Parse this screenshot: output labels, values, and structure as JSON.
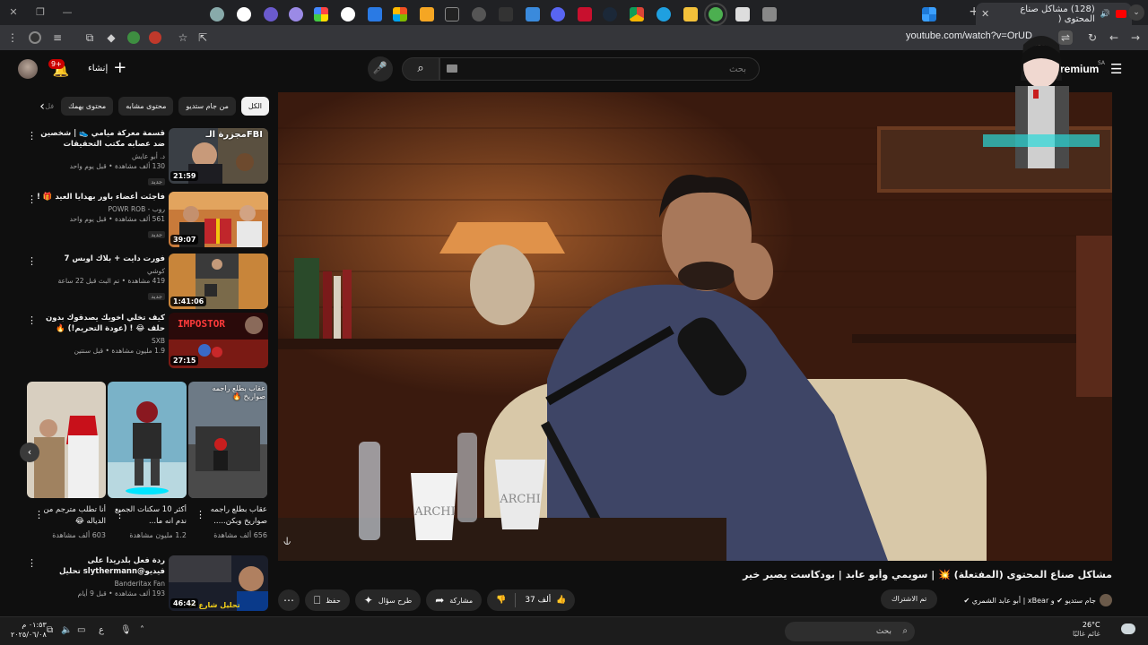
{
  "browser": {
    "tab_title": "(128) مشاكل صناع المحتوى (",
    "url": "youtube.com/watch?v=OrUD"
  },
  "header": {
    "search_placeholder": "بحث",
    "create_label": "إنشاء",
    "notif_badge": "9+",
    "premium_label": "Premium",
    "premium_region": "SA"
  },
  "chips": [
    {
      "label": "الكل",
      "active": true
    },
    {
      "label": "من جام ستديو"
    },
    {
      "label": "محتوى مشابه"
    },
    {
      "label": "محتوى يهمك"
    },
    {
      "label": "فل"
    }
  ],
  "recommendations": [
    {
      "title": "قسمة معركة ميامي 👟 | شخصين ضد عصابه مكتب التحقيقات الفدرالي!",
      "channel": "د. أبو عايش",
      "stats": "130 ألف مشاهدة • قبل يوم واحد",
      "duration": "21:59",
      "badge": "جديد",
      "thumb_text": "مجزرة الـFBI"
    },
    {
      "title": "فاجئت أعضاء باور بهدايا العيد 🎁 !",
      "channel": "روب - POWR ROB",
      "stats": "561 ألف مشاهدة • قبل يوم واحد",
      "duration": "39:07",
      "badge": "جديد",
      "thumb_text": ""
    },
    {
      "title": "فورت دايت + بلاك اوبس 7",
      "channel": "كوشي",
      "stats": "419 مشاهدة • تم البث قبل 22 ساعة",
      "duration": "1:41:06",
      "badge": "جديد",
      "thumb_text": ""
    },
    {
      "title": "كيف تخلي اخويك يصدقوك بدون حلف 😂 ! (عودة التحريم!) 🔥",
      "channel": "SXB",
      "stats": "1.9 مليون مشاهدة • قبل سنتين",
      "duration": "27:15",
      "badge": "",
      "thumb_text": "IMPOSTOR"
    }
  ],
  "shorts": [
    {
      "title": "عقاب بطلع راجمه صواريخ وبكن.....",
      "views": "656 ألف مشاهدة",
      "overlay": "عقاب بطلع راجمه صواريخ 🔥"
    },
    {
      "title": "أكثر 10 سكنات الجميع ندم انه ما...",
      "views": "1.2 مليون مشاهدة",
      "overlay": ""
    },
    {
      "title": "أنا تطلب مترجم من الدياله 😂",
      "views": "603 ألف مشاهدة",
      "overlay": ""
    }
  ],
  "last_rec": {
    "title": "ردة فعل بلدريدا على فيديو@slythermann تحليل مسلسل شا...",
    "channel": "Banderitax Fan",
    "stats": "193 ألف مشاهدة • قبل 9 أيام",
    "duration": "46:42",
    "thumb_text": "تحليل شارع الا"
  },
  "video": {
    "title": "مشاكل صناع المحتوى (المفتعلة) 💥 | سويمي وأبو عابد | بودكاست يصير خير",
    "channel_text": "جام ستديو ✔ و xBear | أبو عابد الشمري ✔",
    "subscribe_label": "تم الاشتراك",
    "likes": "37 ألف",
    "share_label": "مشاركة",
    "ask_label": "طرح سؤال",
    "save_label": "حفظ",
    "cup_text": "ARCHI"
  },
  "taskbar": {
    "search_placeholder": "بحث",
    "temperature": "26°C",
    "weather_cond": "غائم غالبًا",
    "time": "٠١:٥٣ م",
    "date": "٢٠٢٥/٠٦/٠٨"
  }
}
